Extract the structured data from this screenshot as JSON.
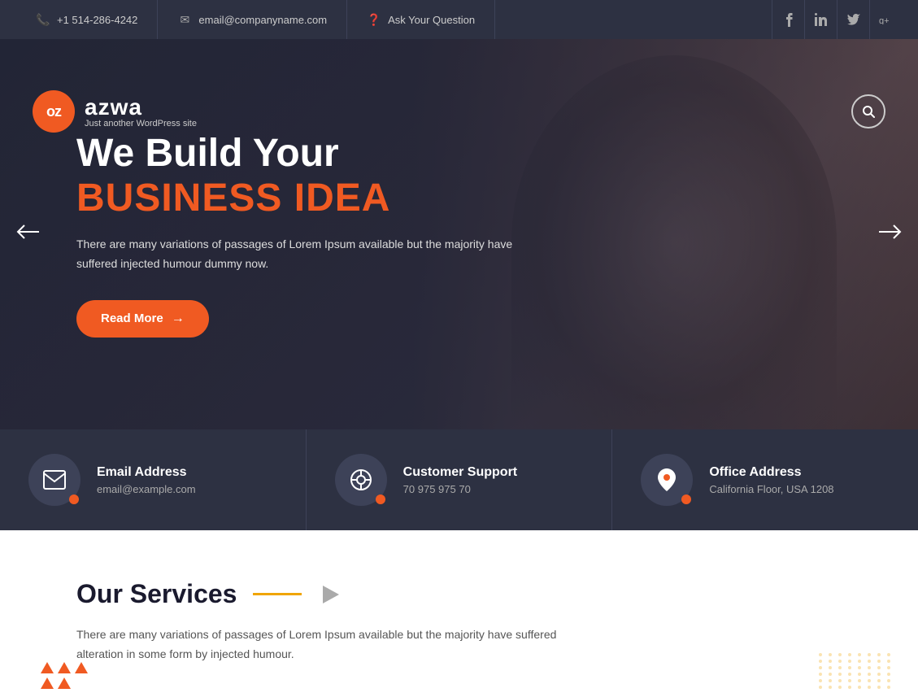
{
  "topbar": {
    "phone": "+1 514-286-4242",
    "email": "email@companyname.com",
    "ask": "Ask Your Question",
    "social": {
      "facebook": "f",
      "linkedin": "in",
      "twitter": "t",
      "googleplus": "g+"
    }
  },
  "header": {
    "logo_letters": "oz",
    "logo_name": "azwa",
    "logo_tagline": "Just another WordPress site"
  },
  "hero": {
    "title_white": "We Build Your",
    "title_orange": "BUSINESS IDEA",
    "description": "There are many variations of passages of Lorem Ipsum available but the majority have suffered injected humour dummy now.",
    "read_more": "Read More"
  },
  "info_cards": [
    {
      "icon": "✉",
      "title": "Email Address",
      "sub": "email@example.com"
    },
    {
      "icon": "⛑",
      "title": "Customer Support",
      "sub": "70 975 975 70"
    },
    {
      "icon": "📍",
      "title": "Office Address",
      "sub": "California Floor, USA 1208"
    }
  ],
  "services": {
    "title": "Our Services",
    "description": "There are many variations of passages of Lorem Ipsum available but the majority have suffered alteration in some form by injected humour."
  }
}
